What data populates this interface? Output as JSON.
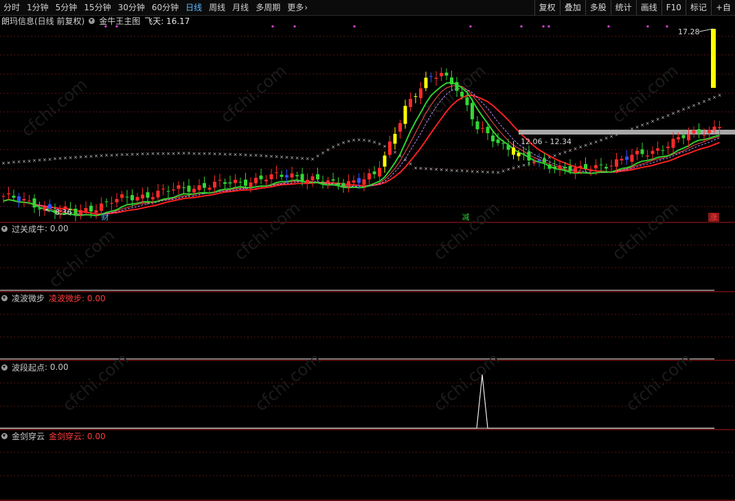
{
  "toolbar": {
    "periods": [
      "分时",
      "1分钟",
      "5分钟",
      "15分钟",
      "30分钟",
      "60分钟",
      "日线",
      "周线",
      "月线",
      "多周期",
      "更多"
    ],
    "active_period": "日线",
    "tools": [
      "复权",
      "叠加",
      "多股",
      "统计",
      "画线",
      "F10",
      "标记",
      "+自"
    ]
  },
  "main_chart": {
    "stock_title": "朗玛信息(日线 前复权)",
    "indicator_name": "金牛王主图",
    "feitian_label": "飞天: 16.17",
    "high_label": "17.28",
    "low_label": "8.36",
    "zone_label": "12.06 - 12.34",
    "event_labels": [
      "财",
      "减",
      "涨"
    ]
  },
  "sub_panels": [
    {
      "name": "过关成牛",
      "value_label": ": 0.00",
      "value_color": "#c8c8c8"
    },
    {
      "name": "凌波微步",
      "value_label": "凌波微步: 0.00",
      "value_color": "#ff3c3c"
    },
    {
      "name": "波段起点",
      "value_label": ": 0.00",
      "value_color": "#c8c8c8"
    },
    {
      "name": "金剑穿云",
      "value_label": "金剑穿云: 0.00",
      "value_color": "#ff3c3c"
    }
  ],
  "watermark": "cfchi.com",
  "colors": {
    "up": "#ff2a2a",
    "down": "#33d633",
    "signal": "#ffff00",
    "blue": "#3050ff",
    "gridline": "#5a1414",
    "border": "#b01818"
  },
  "chart_data": {
    "type": "candlestick",
    "y_range": [
      8.0,
      17.8
    ],
    "low_label": 8.36,
    "high_label": 17.28,
    "zone_range": [
      12.06,
      12.34
    ],
    "feitian": 16.17
  }
}
